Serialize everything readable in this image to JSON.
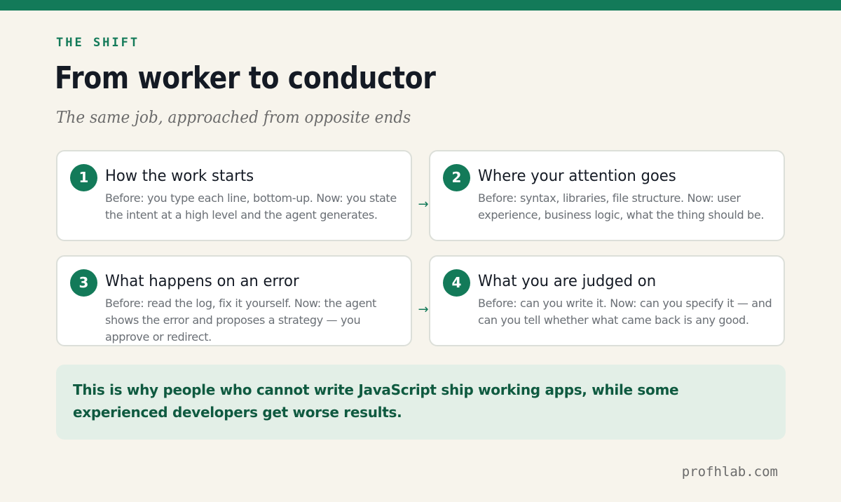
{
  "colors": {
    "accent": "#137a59",
    "background": "#f7f4ec",
    "title": "#141a24",
    "body_text": "#6a6f75",
    "callout_bg": "#e3efe7",
    "callout_text": "#0f5a40"
  },
  "header": {
    "eyebrow": "THE SHIFT",
    "title": "From worker to conductor",
    "subtitle": "The same job, approached from opposite ends"
  },
  "cards": [
    {
      "number": "1",
      "title": "How the work starts",
      "body": "Before: you type each line, bottom-up. Now: you state the intent at a high level and the agent generates."
    },
    {
      "number": "2",
      "title": "Where your attention goes",
      "body": "Before: syntax, libraries, file structure. Now: user experience, business logic, what the thing should be."
    },
    {
      "number": "3",
      "title": "What happens on an error",
      "body": "Before: read the log, fix it yourself. Now: the agent shows the error and proposes a strategy — you approve or redirect."
    },
    {
      "number": "4",
      "title": "What you are judged on",
      "body": "Before: can you write it. Now: can you specify it — and can you tell whether what came back is any good."
    }
  ],
  "arrows": [
    "→",
    "→"
  ],
  "callout": {
    "text": "This is why people who cannot write JavaScript ship working apps, while some experienced developers get worse results."
  },
  "footer": {
    "site": "profhlab.com"
  }
}
